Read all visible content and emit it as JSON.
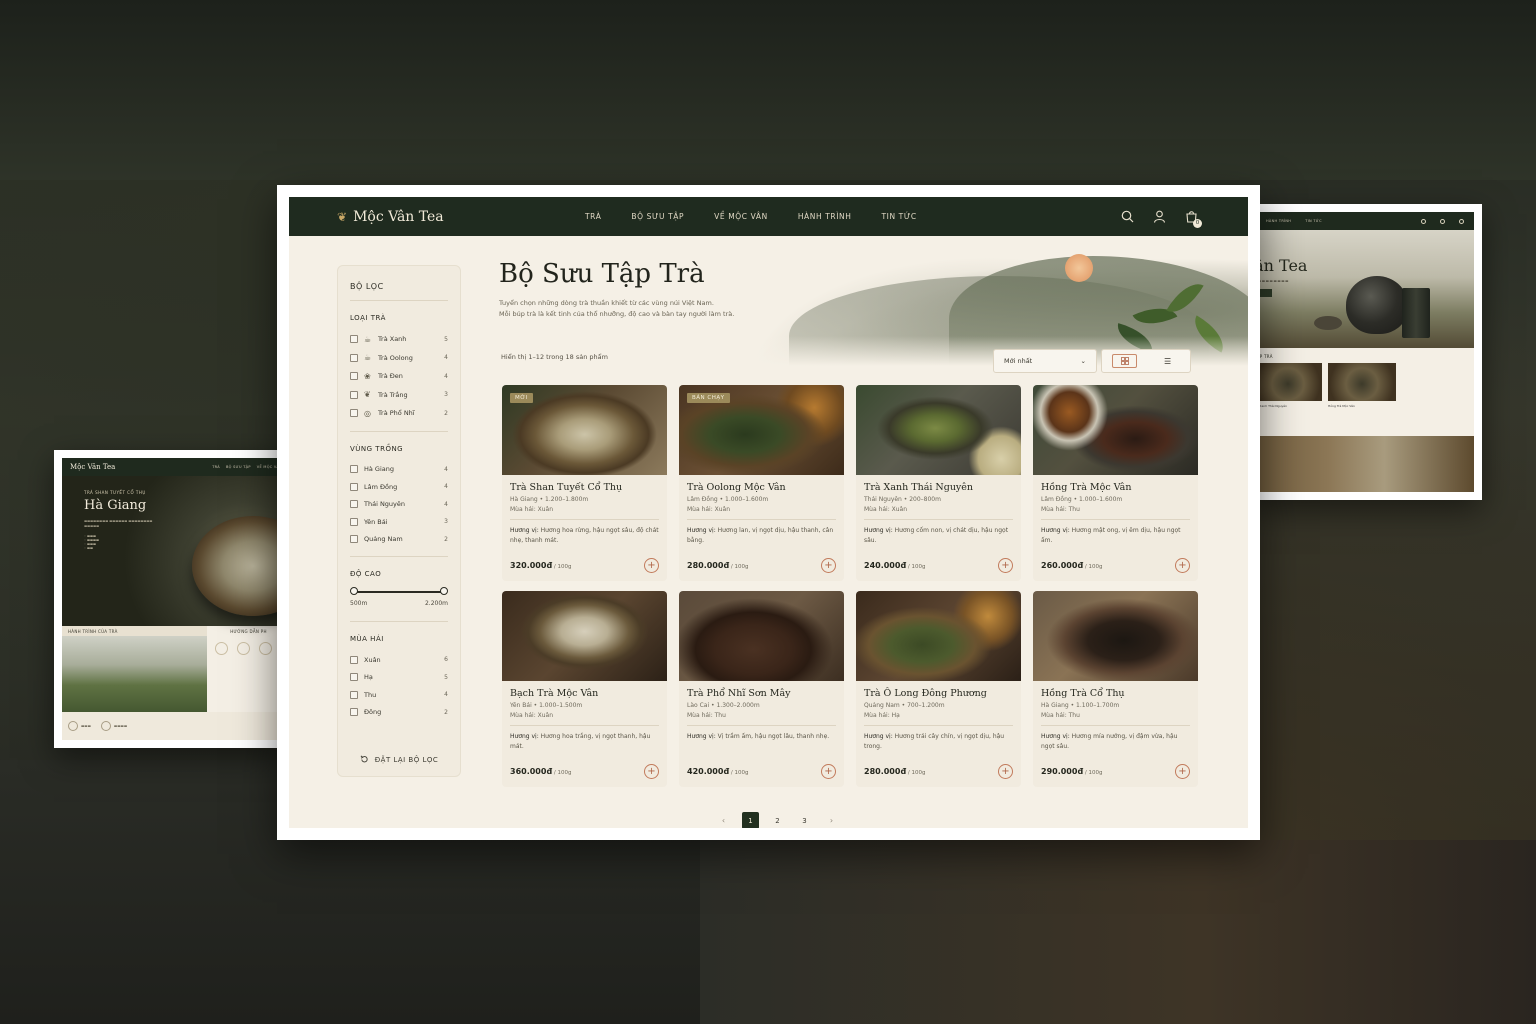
{
  "brand": {
    "name": "Mộc Vân Tea"
  },
  "nav": {
    "links": [
      "TRÀ",
      "BỘ SƯU TẬP",
      "VỀ MỘC VÂN",
      "HÀNH TRÌNH",
      "TIN TỨC"
    ],
    "cart_count": "0",
    "icons": [
      "search-icon",
      "user-icon",
      "cart-icon"
    ]
  },
  "page": {
    "title": "Bộ Sưu Tập Trà",
    "description_line1": "Tuyển chọn những dòng trà thuần khiết từ các vùng núi Việt Nam.",
    "description_line2": "Mỗi búp trà là kết tinh của thổ nhưỡng, độ cao và bàn tay người làm trà.",
    "result_count": "Hiển thị 1–12 trong 18 sản phẩm",
    "sort_value": "Mới nhất"
  },
  "filters": {
    "title": "BỘ LỌC",
    "tea_type": {
      "heading": "LOẠI TRÀ",
      "items": [
        {
          "label": "Trà Xanh",
          "count": "5"
        },
        {
          "label": "Trà Oolong",
          "count": "4"
        },
        {
          "label": "Trà Đen",
          "count": "4"
        },
        {
          "label": "Trà Trắng",
          "count": "3"
        },
        {
          "label": "Trà Phổ Nhĩ",
          "count": "2"
        }
      ]
    },
    "region": {
      "heading": "VÙNG TRỒNG",
      "items": [
        {
          "label": "Hà Giang",
          "count": "4"
        },
        {
          "label": "Lâm Đồng",
          "count": "4"
        },
        {
          "label": "Thái Nguyên",
          "count": "4"
        },
        {
          "label": "Yên Bái",
          "count": "3"
        },
        {
          "label": "Quảng Nam",
          "count": "2"
        }
      ]
    },
    "altitude": {
      "heading": "ĐỘ CAO",
      "min_label": "500m",
      "max_label": "2.200m"
    },
    "season": {
      "heading": "MÙA HÁI",
      "items": [
        {
          "label": "Xuân",
          "count": "6"
        },
        {
          "label": "Hạ",
          "count": "5"
        },
        {
          "label": "Thu",
          "count": "4"
        },
        {
          "label": "Đông",
          "count": "2"
        }
      ]
    },
    "reset_label": "ĐẶT LẠI BỘ LỌC"
  },
  "products": [
    {
      "name": "Trà Shan Tuyết Cổ Thụ",
      "badge": "MỚI",
      "meta": "Hà Giang • 1.200–1.800m",
      "season": "Mùa hái: Xuân",
      "flavor_label": "Hương vị:",
      "flavor": "Hương hoa rừng, hậu ngọt sâu, độ chát nhẹ, thanh mát.",
      "price": "320.000đ",
      "unit": " / 100g"
    },
    {
      "name": "Trà Oolong Mộc Vân",
      "badge": "BÁN CHẠY",
      "meta": "Lâm Đồng • 1.000–1.600m",
      "season": "Mùa hái: Xuân",
      "flavor_label": "Hương vị:",
      "flavor": "Hương lan, vị ngọt dịu, hậu thanh, cân bằng.",
      "price": "280.000đ",
      "unit": " / 100g"
    },
    {
      "name": "Trà Xanh Thái Nguyên",
      "badge": "",
      "meta": "Thái Nguyên • 200–800m",
      "season": "Mùa hái: Xuân",
      "flavor_label": "Hương vị:",
      "flavor": "Hương cốm non, vị chát dịu, hậu ngọt sâu.",
      "price": "240.000đ",
      "unit": " / 100g"
    },
    {
      "name": "Hồng Trà Mộc Vân",
      "badge": "",
      "meta": "Lâm Đồng • 1.000–1.600m",
      "season": "Mùa hái: Thu",
      "flavor_label": "Hương vị:",
      "flavor": "Hương mật ong, vị êm dịu, hậu ngọt ấm.",
      "price": "260.000đ",
      "unit": " / 100g"
    },
    {
      "name": "Bạch Trà Mộc Vân",
      "badge": "",
      "meta": "Yên Bái • 1.000–1.500m",
      "season": "Mùa hái: Xuân",
      "flavor_label": "Hương vị:",
      "flavor": "Hương hoa trắng, vị ngọt thanh, hậu mát.",
      "price": "360.000đ",
      "unit": " / 100g"
    },
    {
      "name": "Trà Phổ Nhĩ Sơn Mây",
      "badge": "",
      "meta": "Lào Cai • 1.300–2.000m",
      "season": "Mùa hái: Thu",
      "flavor_label": "Hương vị:",
      "flavor": "Vị trầm ấm, hậu ngọt lâu, thanh nhẹ.",
      "price": "420.000đ",
      "unit": " / 100g"
    },
    {
      "name": "Trà Ô Long Đông Phương",
      "badge": "",
      "meta": "Quảng Nam • 700–1.200m",
      "season": "Mùa hái: Hạ",
      "flavor_label": "Hương vị:",
      "flavor": "Hương trái cây chín, vị ngọt dịu, hậu trong.",
      "price": "280.000đ",
      "unit": " / 100g"
    },
    {
      "name": "Hồng Trà Cổ Thụ",
      "badge": "",
      "meta": "Hà Giang • 1.100–1.700m",
      "season": "Mùa hái: Thu",
      "flavor_label": "Hương vị:",
      "flavor": "Hương mía nướng, vị đậm vừa, hậu ngọt sâu.",
      "price": "290.000đ",
      "unit": " / 100g"
    }
  ],
  "pagination": {
    "pages": [
      "1",
      "2",
      "3"
    ],
    "current": "1",
    "prev": "‹",
    "next": "›"
  },
  "left_preview": {
    "brand": "Mộc Vân Tea",
    "nav": [
      "TRÀ",
      "BỘ SƯU TẬP",
      "VỀ MỘC VÂN"
    ],
    "kicker": "TRÀ SHAN TUYẾT CỔ THỤ",
    "title": "Hà Giang",
    "journey_heading": "HÀNH TRÌNH CỦA TRÀ",
    "guide_heading": "HƯỚNG DẪN PH"
  },
  "right_preview": {
    "nav": [
      "HÀNH TRÌNH",
      "TIN TỨC"
    ],
    "title": "Vân Tea",
    "collection_heading": "TẬP TRÀ",
    "card1": "Trà Xanh Thái Nguyên",
    "card2": "Hồng Trà Mộc Vân"
  },
  "colors": {
    "nav_bg": "#1f2b1f",
    "page_bg": "#f5f0e6",
    "accent": "#c27b5c",
    "badge": "#9b8a5a"
  }
}
